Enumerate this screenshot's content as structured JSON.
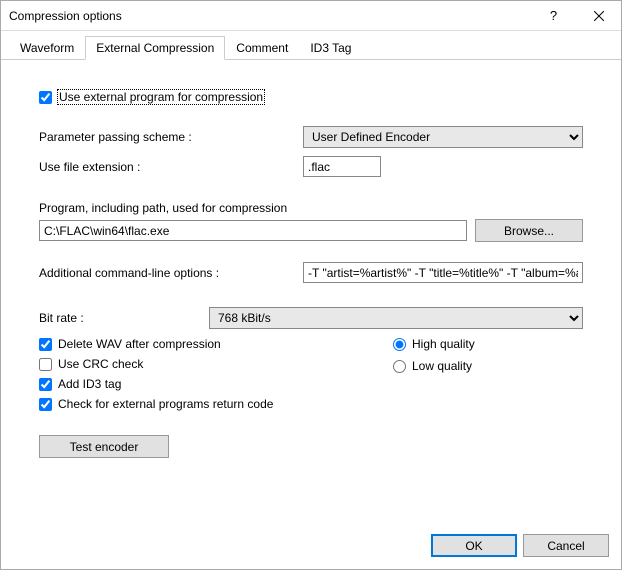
{
  "window": {
    "title": "Compression options"
  },
  "tabs": {
    "waveform": "Waveform",
    "external": "External Compression",
    "comment": "Comment",
    "id3": "ID3 Tag"
  },
  "form": {
    "use_external_label": "Use external program for compression",
    "use_external_checked": true,
    "param_scheme_label": "Parameter passing scheme :",
    "param_scheme_value": "User Defined Encoder",
    "file_ext_label": "Use file extension :",
    "file_ext_value": ".flac",
    "program_label": "Program, including path, used for compression",
    "program_value": "C:\\FLAC\\win64\\flac.exe",
    "browse_label": "Browse...",
    "addl_label": "Additional command-line options :",
    "addl_value": "-T \"artist=%artist%\" -T \"title=%title%\" -T \"album=%album%\"",
    "bitrate_label": "Bit rate :",
    "bitrate_value": "768 kBit/s",
    "delete_wav_label": "Delete WAV after compression",
    "delete_wav_checked": true,
    "crc_label": "Use CRC check",
    "crc_checked": false,
    "id3_label": "Add ID3 tag",
    "id3_checked": true,
    "retcode_label": "Check for external programs return code",
    "retcode_checked": true,
    "high_quality_label": "High quality",
    "low_quality_label": "Low quality",
    "quality_selected": "high",
    "test_label": "Test encoder"
  },
  "footer": {
    "ok": "OK",
    "cancel": "Cancel"
  }
}
